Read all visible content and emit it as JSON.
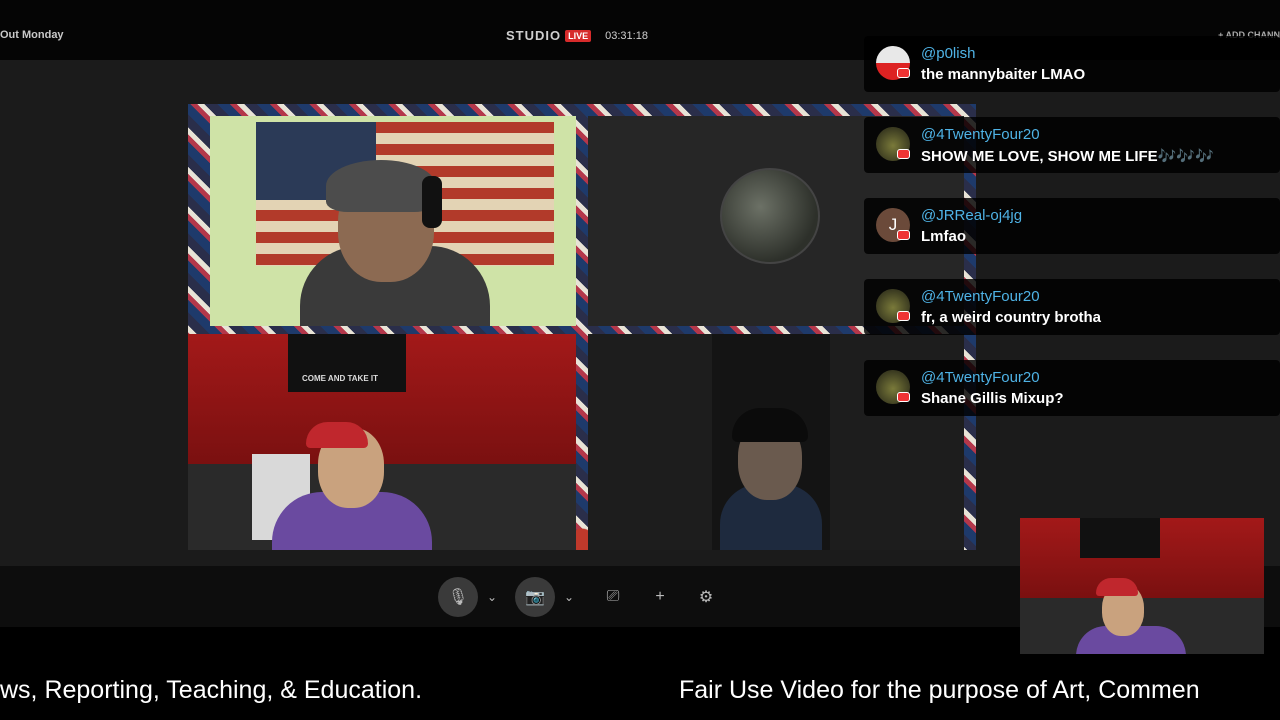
{
  "header": {
    "title": "Out Monday",
    "studio_label": "STUDIO",
    "live_badge": "LIVE",
    "timer": "03:31:18",
    "add_channel": "+ ADD CHANN"
  },
  "stage": {
    "banner_text": "COME AND TAKE IT"
  },
  "controls": {
    "mic_icon": "microphone-icon",
    "camera_icon": "video-camera-icon",
    "share_icon": "screen-share-icon",
    "add_icon": "plus-icon",
    "settings_icon": "gear-icon",
    "glyphs": {
      "mic": "🎙",
      "chevron": "⌄",
      "camera": "📷",
      "share": "⎚",
      "add": "+",
      "settings": "⚙"
    }
  },
  "chat": {
    "messages": [
      {
        "user": "@p0lish",
        "text": "the mannybaiter LMAO",
        "avatar": ""
      },
      {
        "user": "@4TwentyFour20",
        "text": "SHOW ME LOVE, SHOW ME LIFE🎶🎶🎶",
        "avatar": ""
      },
      {
        "user": "@JRReal-oj4jg",
        "text": "Lmfao",
        "avatar": "J"
      },
      {
        "user": "@4TwentyFour20",
        "text": "fr, a weird country brotha",
        "avatar": ""
      },
      {
        "user": "@4TwentyFour20",
        "text": "Shane Gillis Mixup?",
        "avatar": ""
      }
    ]
  },
  "ticker": {
    "left": "ws, Reporting, Teaching, & Education.",
    "right": "Fair Use Video for the purpose of Art, Commen"
  }
}
